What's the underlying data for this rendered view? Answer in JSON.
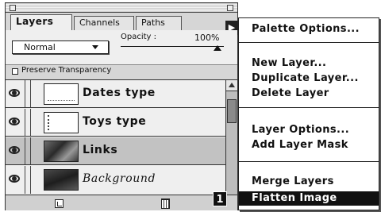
{
  "palette": {
    "tabs": [
      {
        "label": "Layers",
        "active": true
      },
      {
        "label": "Channels",
        "active": false
      },
      {
        "label": "Paths",
        "active": false
      }
    ],
    "blend_mode": "Normal",
    "opacity_label": "Opacity :",
    "opacity_value": "100%",
    "preserve_transparency_label": "Preserve Transparency",
    "preserve_transparency_checked": false,
    "layers": [
      {
        "name": "Dates type",
        "visible": true,
        "selected": false,
        "thumbnail": "type-layer"
      },
      {
        "name": "Toys type",
        "visible": true,
        "selected": false,
        "thumbnail": "type-layer"
      },
      {
        "name": "Links",
        "visible": true,
        "selected": true,
        "thumbnail": "image-layer"
      },
      {
        "name": "Background",
        "visible": true,
        "selected": false,
        "thumbnail": "image-layer"
      }
    ],
    "menu_arrow_icon": "triangle-right-icon",
    "new_layer_icon": "new-layer-icon",
    "trash_icon": "trash-icon"
  },
  "menu": {
    "groups": [
      [
        "Palette Options..."
      ],
      [
        "New Layer...",
        "Duplicate Layer...",
        "Delete Layer"
      ],
      [
        "Layer Options...",
        "Add Layer Mask"
      ],
      [
        "Merge Layers",
        "Flatten Image"
      ]
    ],
    "highlighted": "Flatten Image"
  },
  "callout": "1"
}
